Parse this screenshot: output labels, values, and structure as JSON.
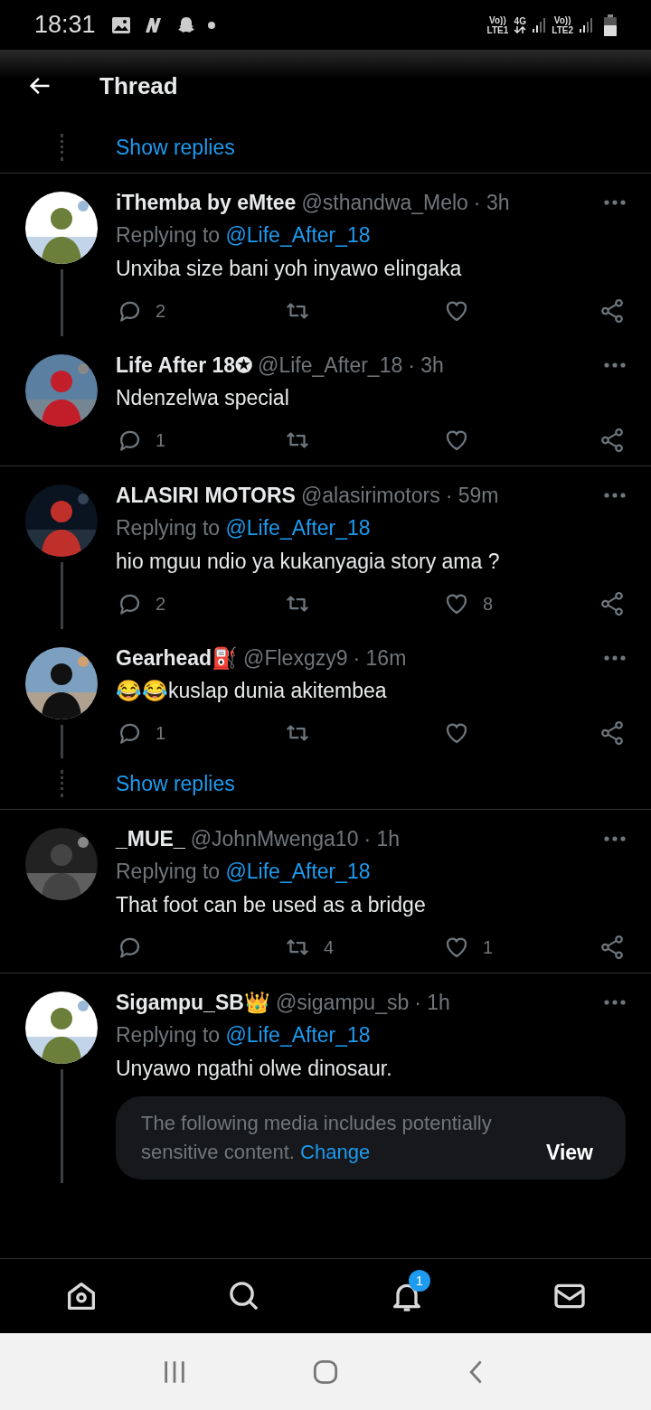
{
  "status_bar": {
    "time": "18:31",
    "sim1_label": "Vo))",
    "sim1_net": "LTE1",
    "data_label": "4G",
    "sim2_label": "Vo))",
    "sim2_net": "LTE2"
  },
  "header": {
    "title": "Thread"
  },
  "feed": [
    {
      "kind": "show_replies",
      "label": "Show replies",
      "divider_below": true
    },
    {
      "kind": "tweet",
      "name": "iThemba by eMtee",
      "handle": "@sthandwa_Melo",
      "time": "· 3h",
      "replying_prefix": "Replying to",
      "replying_to": "@Life_After_18",
      "text": "Unxiba size bani yoh inyawo elingaka",
      "replies": "2",
      "thread_below": true,
      "divider_below": false
    },
    {
      "kind": "tweet",
      "name": "Life After 18✪",
      "handle": "@Life_After_18",
      "time": "· 3h",
      "text": "Ndenzelwa special",
      "replies": "1",
      "thread_below": false,
      "divider_below": true
    },
    {
      "kind": "tweet",
      "name": "ALASIRI MOTORS",
      "handle": "@alasirimotors",
      "time": "· 59m",
      "replying_prefix": "Replying to",
      "replying_to": "@Life_After_18",
      "text": "hio mguu ndio ya kukanyagia story ama ?",
      "replies": "2",
      "likes": "8",
      "thread_below": true,
      "divider_below": false
    },
    {
      "kind": "tweet",
      "name": "Gearhead⛽",
      "handle": "@Flexgzy9",
      "time": "· 16m",
      "text": "😂😂kuslap dunia akitembea",
      "replies": "1",
      "thread_below": true,
      "divider_below": false
    },
    {
      "kind": "show_replies",
      "label": "Show replies",
      "divider_below": true
    },
    {
      "kind": "tweet",
      "name": "_MUE_",
      "handle": "@JohnMwenga10",
      "time": "· 1h",
      "replying_prefix": "Replying to",
      "replying_to": "@Life_After_18",
      "text": "That foot can be used as a bridge",
      "retweets": "4",
      "likes": "1",
      "thread_below": false,
      "divider_below": true
    },
    {
      "kind": "tweet",
      "name": "Sigampu_SB👑",
      "handle": "@sigampu_sb",
      "time": "· 1h",
      "replying_prefix": "Replying to",
      "replying_to": "@Life_After_18",
      "text": "Unyawo ngathi olwe dinosaur.",
      "thread_below": true,
      "divider_below": false,
      "media_notice": {
        "text": "The following media includes potentially sensitive content.",
        "link": "Change",
        "button": "View"
      }
    }
  ],
  "bottom_nav": [
    {
      "selected": false
    },
    {
      "selected": false
    },
    {
      "selected": false,
      "badge": "1"
    },
    {
      "selected": false
    }
  ]
}
